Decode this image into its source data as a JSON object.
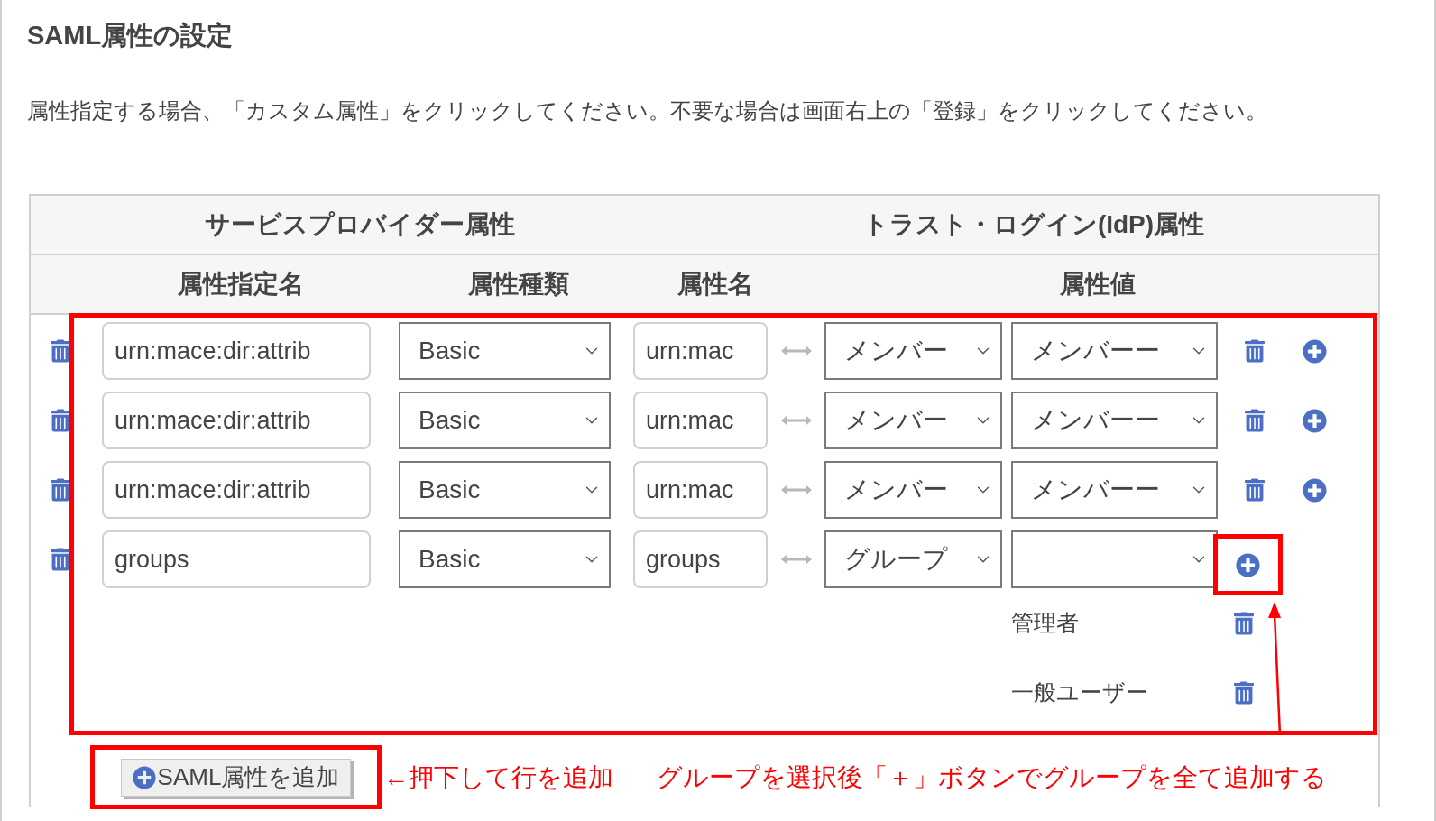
{
  "title": "SAML属性の設定",
  "description": "属性指定する場合、「カスタム属性」をクリックしてください。不要な場合は画面右上の「登録」をクリックしてください。",
  "table": {
    "group_headers": [
      "サービスプロバイダー属性",
      "トラスト・ログイン(IdP)属性"
    ],
    "columns": [
      "属性指定名",
      "属性種類",
      "属性名",
      "属性値"
    ],
    "highlighted": true,
    "rows": [
      {
        "kind": "single",
        "name": "urn:mace:dir:attrib",
        "type": "Basic",
        "attribute": "urn:mac",
        "idp_attribute": "メンバー",
        "idp_value": "メンバーー"
      },
      {
        "kind": "single",
        "name": "urn:mace:dir:attrib",
        "type": "Basic",
        "attribute": "urn:mac",
        "idp_attribute": "メンバー",
        "idp_value": "メンバーー"
      },
      {
        "kind": "single",
        "name": "urn:mace:dir:attrib",
        "type": "Basic",
        "attribute": "urn:mac",
        "idp_attribute": "メンバー",
        "idp_value": "メンバーー"
      },
      {
        "kind": "group",
        "name": "groups",
        "type": "Basic",
        "attribute": "groups",
        "idp_attribute": "グループ",
        "add_highlighted": true,
        "values": [
          "管理者",
          "一般ユーザー"
        ]
      }
    ]
  },
  "add_button": {
    "label": "SAML属性を追加",
    "highlighted": true
  },
  "annotations": [
    "←押下して行を追加",
    "グループを選択後「＋」ボタンでグループを全て追加する"
  ]
}
